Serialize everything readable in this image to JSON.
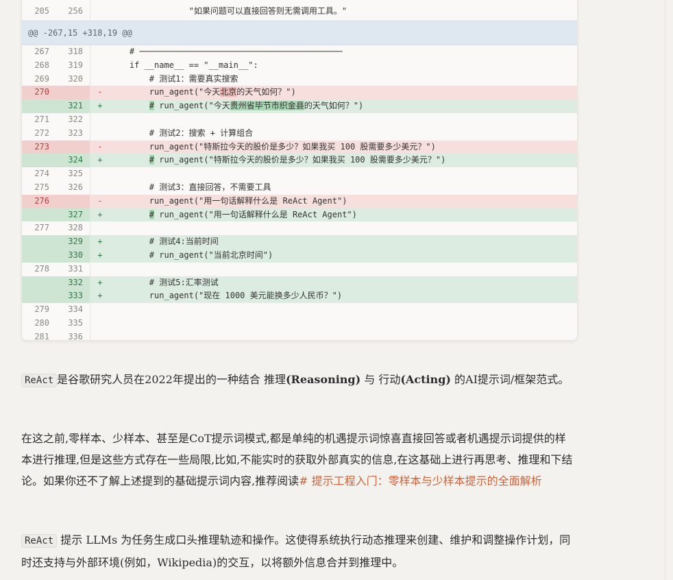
{
  "diff": {
    "first_row": {
      "old": "205",
      "new": "256",
      "code": "                \"如果问题可以直接回答则无需调用工具。\""
    },
    "hunk_header": "@@ -267,15 +318,19 @@",
    "rows": [
      {
        "type": "ctx",
        "old": "267",
        "new": "318",
        "sign": "",
        "parts": [
          {
            "t": "    # ─────────────────────────────────────────"
          }
        ]
      },
      {
        "type": "ctx",
        "old": "268",
        "new": "319",
        "sign": "",
        "parts": [
          {
            "t": "    if __name__ == \"__main__\":"
          }
        ]
      },
      {
        "type": "ctx",
        "old": "269",
        "new": "320",
        "sign": "",
        "parts": [
          {
            "t": "        # 测试1：需要真实搜索"
          }
        ]
      },
      {
        "type": "del",
        "old": "270",
        "new": "",
        "sign": "-",
        "parts": [
          {
            "t": "        run_agent(\"今天"
          },
          {
            "t": "北京",
            "hl": true
          },
          {
            "t": "的天气如何？\")"
          }
        ]
      },
      {
        "type": "add",
        "old": "",
        "new": "321",
        "sign": "+",
        "parts": [
          {
            "t": "        "
          },
          {
            "t": "#",
            "hl": true
          },
          {
            "t": " run_agent(\"今天"
          },
          {
            "t": "贵州省毕节市织金县",
            "hl": true
          },
          {
            "t": "的天气如何？\")"
          }
        ]
      },
      {
        "type": "ctx",
        "old": "271",
        "new": "322",
        "sign": "",
        "parts": [
          {
            "t": ""
          }
        ]
      },
      {
        "type": "ctx",
        "old": "272",
        "new": "323",
        "sign": "",
        "parts": [
          {
            "t": "        # 测试2：搜索 + 计算组合"
          }
        ]
      },
      {
        "type": "del",
        "old": "273",
        "new": "",
        "sign": "-",
        "parts": [
          {
            "t": "        run_agent(\"特斯拉今天的股价是多少？如果我买 100 股需要多少美元？\")"
          }
        ]
      },
      {
        "type": "add",
        "old": "",
        "new": "324",
        "sign": "+",
        "parts": [
          {
            "t": "        "
          },
          {
            "t": "#",
            "hl": true
          },
          {
            "t": " run_agent(\"特斯拉今天的股价是多少？如果我买 100 股需要多少美元？\")"
          }
        ]
      },
      {
        "type": "ctx",
        "old": "274",
        "new": "325",
        "sign": "",
        "parts": [
          {
            "t": ""
          }
        ]
      },
      {
        "type": "ctx",
        "old": "275",
        "new": "326",
        "sign": "",
        "parts": [
          {
            "t": "        # 测试3：直接回答，不需要工具"
          }
        ]
      },
      {
        "type": "del",
        "old": "276",
        "new": "",
        "sign": "-",
        "parts": [
          {
            "t": "        run_agent(\"用一句话解释什么是 ReAct Agent\")"
          }
        ]
      },
      {
        "type": "add",
        "old": "",
        "new": "327",
        "sign": "+",
        "parts": [
          {
            "t": "        "
          },
          {
            "t": "#",
            "hl": true
          },
          {
            "t": " run_agent(\"用一句话解释什么是 ReAct Agent\")"
          }
        ]
      },
      {
        "type": "ctx",
        "old": "277",
        "new": "328",
        "sign": "",
        "parts": [
          {
            "t": ""
          }
        ]
      },
      {
        "type": "add",
        "old": "",
        "new": "329",
        "sign": "+",
        "parts": [
          {
            "t": "        # 测试4:当前时间"
          }
        ]
      },
      {
        "type": "add",
        "old": "",
        "new": "330",
        "sign": "+",
        "parts": [
          {
            "t": "        # run_agent(\"当前北京时间\")"
          }
        ]
      },
      {
        "type": "ctx",
        "old": "278",
        "new": "331",
        "sign": "",
        "parts": [
          {
            "t": ""
          }
        ]
      },
      {
        "type": "add",
        "old": "",
        "new": "332",
        "sign": "+",
        "parts": [
          {
            "t": "        # 测试5:汇率测试"
          }
        ]
      },
      {
        "type": "add",
        "old": "",
        "new": "333",
        "sign": "+",
        "parts": [
          {
            "t": "        run_agent(\"现在 1000 美元能换多少人民币？\")"
          }
        ]
      },
      {
        "type": "ctx",
        "old": "279",
        "new": "334",
        "sign": "",
        "parts": [
          {
            "t": ""
          }
        ]
      },
      {
        "type": "ctx",
        "old": "280",
        "new": "335",
        "sign": "",
        "parts": [
          {
            "t": ""
          }
        ]
      },
      {
        "type": "ctx",
        "old": "281",
        "new": "336",
        "sign": "",
        "parts": [
          {
            "t": ""
          }
        ]
      }
    ]
  },
  "article": {
    "p1": {
      "chip": "ReAct",
      "t1": "是谷歌研究人员在2022年提出的一种结合 推理",
      "b1": "(Reasoning)",
      "t2": " 与 行动",
      "b2": "(Acting)",
      "t3": " 的AI提示词/框架范式。"
    },
    "p2": {
      "text": "在这之前,零样本、少样本、甚至是CoT提示词模式,都是单纯的机遇提示词惊喜直接回答或者机遇提示词提供的样本进行推理,但是这些方式存在一些局限,比如,不能实时的获取外部真实的信息,在这基础上进行再思考、推理和下结论。如果你还不了解上述提到的基础提示词内容,推荐阅读",
      "link": "# 提示工程入门：零样本与少样本提示的全面解析"
    },
    "p3": {
      "chip": "ReAct",
      "text": "提示 LLMs 为任务生成口头推理轨迹和操作。这使得系统执行动态推理来创建、维护和调整操作计划，同时还支持与外部环境(例如，Wikipedia)的交互，以将额外信息合并到推理中。"
    }
  }
}
